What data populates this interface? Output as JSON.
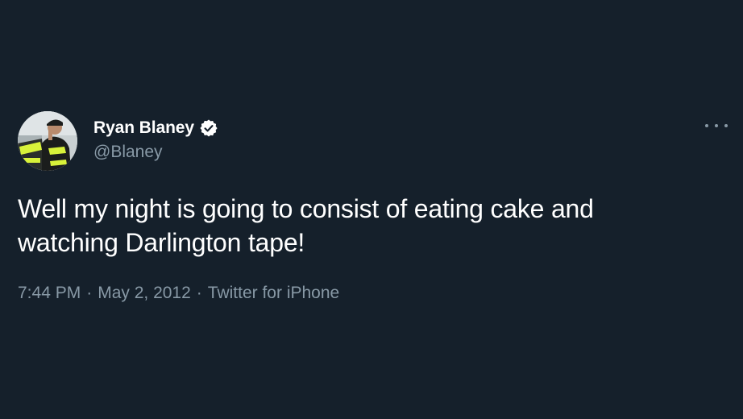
{
  "tweet": {
    "display_name": "Ryan Blaney",
    "handle": "@Blaney",
    "verified": true,
    "text": "Well my night is going to consist of eating cake and watching Darlington tape!",
    "time": "7:44 PM",
    "date": "May 2, 2012",
    "source": "Twitter for iPhone",
    "separator": "·",
    "more_icon": "more-horizontal-icon",
    "verified_icon": "verified-badge-icon"
  },
  "colors": {
    "background": "#15202b",
    "primary_text": "#ffffff",
    "secondary_text": "#8899a6"
  }
}
